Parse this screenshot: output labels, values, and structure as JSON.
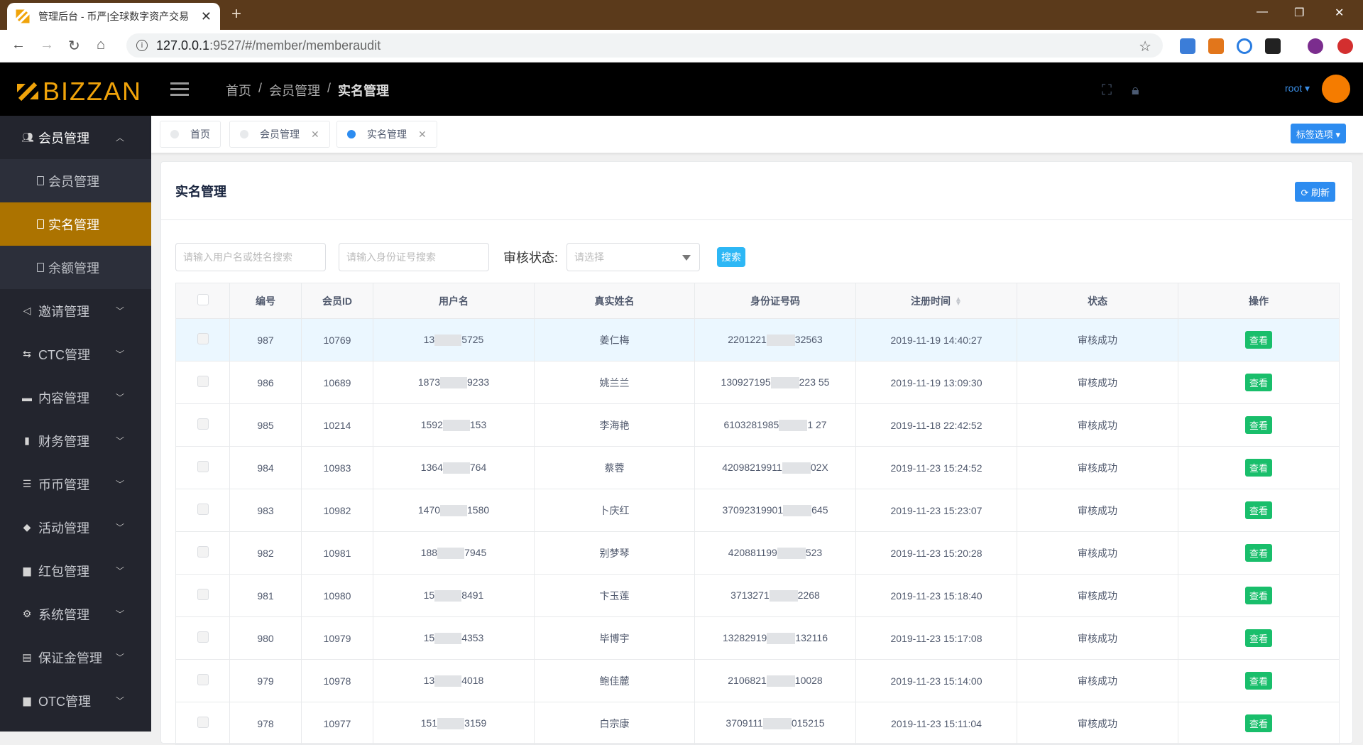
{
  "browser": {
    "tab_title": "管理后台 - 币严|全球数字资产交易",
    "url_host": "127.0.0.1",
    "url_rest": ":9527/#/member/memberaudit",
    "new_tab": "+",
    "min": "—",
    "restore": "❐",
    "close": "✕"
  },
  "header": {
    "logo_text": "BIZZAN",
    "breadcrumb": [
      "首页",
      "会员管理",
      "实名管理"
    ],
    "separator": "/",
    "user": "root ▾",
    "brand_color": "#f0a30a"
  },
  "sidebar": {
    "groups": [
      {
        "label": "会员管理",
        "icon": "users-icon",
        "glyph": "👥",
        "expanded": true,
        "children": [
          {
            "label": "会员管理",
            "active": false
          },
          {
            "label": "实名管理",
            "active": true
          },
          {
            "label": "余额管理",
            "active": false
          }
        ]
      },
      {
        "label": "邀请管理",
        "icon": "share-icon",
        "glyph": "<"
      },
      {
        "label": "CTC管理",
        "icon": "swap-icon",
        "glyph": "⇆"
      },
      {
        "label": "内容管理",
        "icon": "folder-icon",
        "glyph": "▬"
      },
      {
        "label": "财务管理",
        "icon": "bar-chart-icon",
        "glyph": "▮"
      },
      {
        "label": "币币管理",
        "icon": "exchange-icon",
        "glyph": "☰"
      },
      {
        "label": "活动管理",
        "icon": "cube-icon",
        "glyph": "◆"
      },
      {
        "label": "红包管理",
        "icon": "briefcase-icon",
        "glyph": "▆"
      },
      {
        "label": "系统管理",
        "icon": "gear-icon",
        "glyph": "⚙"
      },
      {
        "label": "保证金管理",
        "icon": "card-icon",
        "glyph": "▤"
      },
      {
        "label": "OTC管理",
        "icon": "case-icon",
        "glyph": "▆"
      }
    ],
    "active_color": "#ac7300"
  },
  "tags": {
    "items": [
      {
        "label": "首页",
        "closable": false,
        "active": false
      },
      {
        "label": "会员管理",
        "closable": true,
        "active": false
      },
      {
        "label": "实名管理",
        "closable": true,
        "active": true
      }
    ],
    "options_label": "标签选项 ▾"
  },
  "card": {
    "title": "实名管理",
    "refresh_label": "⟳ 刷新"
  },
  "filters": {
    "name_placeholder": "请输入用户名或姓名搜索",
    "id_placeholder": "请输入身份证号搜索",
    "status_label": "审核状态:",
    "status_placeholder": "请选择",
    "search_label": "搜索"
  },
  "table": {
    "columns": [
      "编号",
      "会员ID",
      "用户名",
      "真实姓名",
      "身份证号码",
      "注册时间",
      "状态",
      "操作"
    ],
    "action_label": "查看",
    "rows": [
      {
        "no": "987",
        "member_id": "10769",
        "user_a": "13",
        "user_b": "5725",
        "name": "姜仁梅",
        "id_a": "2201221",
        "id_b": "32563",
        "time": "2019-11-19 14:40:27",
        "status": "审核成功",
        "highlight": true
      },
      {
        "no": "986",
        "member_id": "10689",
        "user_a": "1873",
        "user_b": "9233",
        "name": "姚兰兰",
        "id_a": "130927195",
        "id_b": "223 55",
        "time": "2019-11-19 13:09:30",
        "status": "审核成功"
      },
      {
        "no": "985",
        "member_id": "10214",
        "user_a": "1592",
        "user_b": "153",
        "name": "李海艳",
        "id_a": "6103281985",
        "id_b": "1 27",
        "time": "2019-11-18 22:42:52",
        "status": "审核成功"
      },
      {
        "no": "984",
        "member_id": "10983",
        "user_a": "1364",
        "user_b": "764",
        "name": "蔡蓉",
        "id_a": "42098219911",
        "id_b": "02X",
        "time": "2019-11-23 15:24:52",
        "status": "审核成功"
      },
      {
        "no": "983",
        "member_id": "10982",
        "user_a": "1470",
        "user_b": "1580",
        "name": "卜庆红",
        "id_a": "37092319901",
        "id_b": "645",
        "time": "2019-11-23 15:23:07",
        "status": "审核成功"
      },
      {
        "no": "982",
        "member_id": "10981",
        "user_a": "188",
        "user_b": "7945",
        "name": "别梦琴",
        "id_a": "420881199",
        "id_b": "523",
        "time": "2019-11-23 15:20:28",
        "status": "审核成功"
      },
      {
        "no": "981",
        "member_id": "10980",
        "user_a": "15",
        "user_b": "8491",
        "name": "卞玉莲",
        "id_a": "3713271",
        "id_b": "2268",
        "time": "2019-11-23 15:18:40",
        "status": "审核成功"
      },
      {
        "no": "980",
        "member_id": "10979",
        "user_a": "15",
        "user_b": "4353",
        "name": "毕博宇",
        "id_a": "13282919",
        "id_b": "132116",
        "time": "2019-11-23 15:17:08",
        "status": "审核成功"
      },
      {
        "no": "979",
        "member_id": "10978",
        "user_a": "13",
        "user_b": "4018",
        "name": "鲍佳麓",
        "id_a": "2106821",
        "id_b": "10028",
        "time": "2019-11-23 15:14:00",
        "status": "审核成功"
      },
      {
        "no": "978",
        "member_id": "10977",
        "user_a": "151",
        "user_b": "3159",
        "name": "白宗康",
        "id_a": "3709111",
        "id_b": "015215",
        "time": "2019-11-23 15:11:04",
        "status": "审核成功"
      }
    ]
  }
}
